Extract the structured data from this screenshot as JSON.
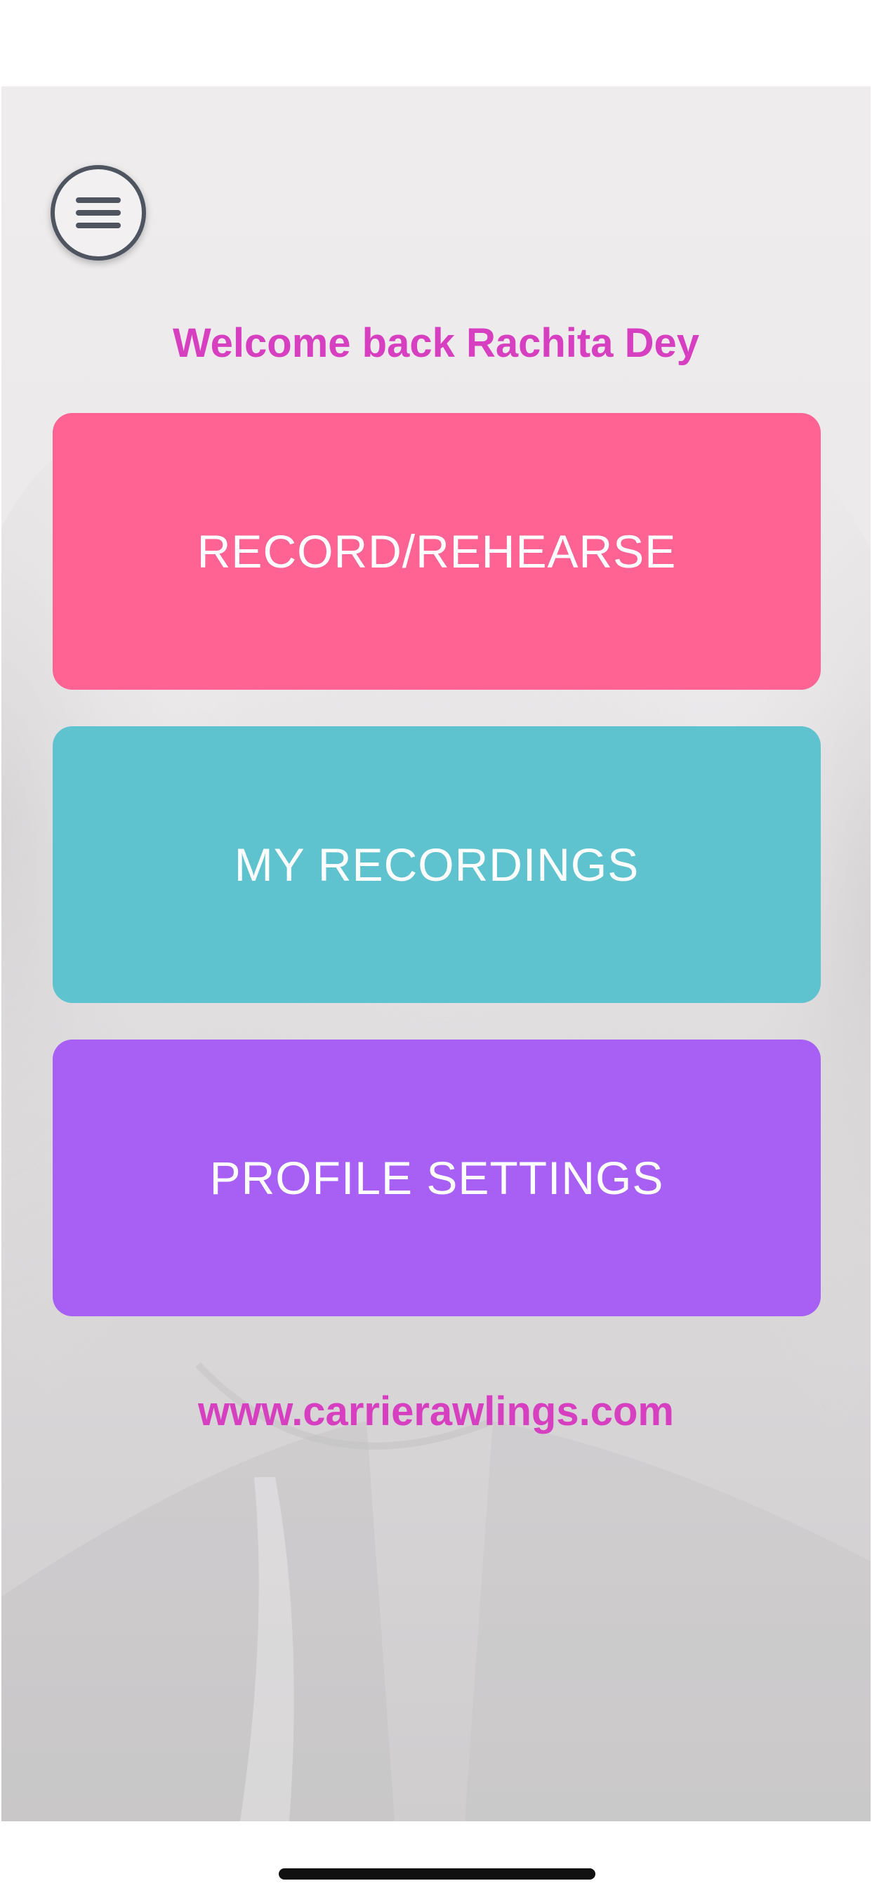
{
  "menu": {
    "icon": "hamburger-menu-icon"
  },
  "welcome_text": "Welcome back Rachita Dey",
  "buttons": {
    "record": {
      "label": "RECORD/REHEARSE",
      "color": "#fe6394"
    },
    "recordings": {
      "label": "MY RECORDINGS",
      "color": "#5ec2cf"
    },
    "profile": {
      "label": "PROFILE SETTINGS",
      "color": "#a860f4"
    }
  },
  "website": "www.carrierawlings.com",
  "colors": {
    "accent_text": "#d63fc0",
    "menu_outline": "#4e5561"
  }
}
